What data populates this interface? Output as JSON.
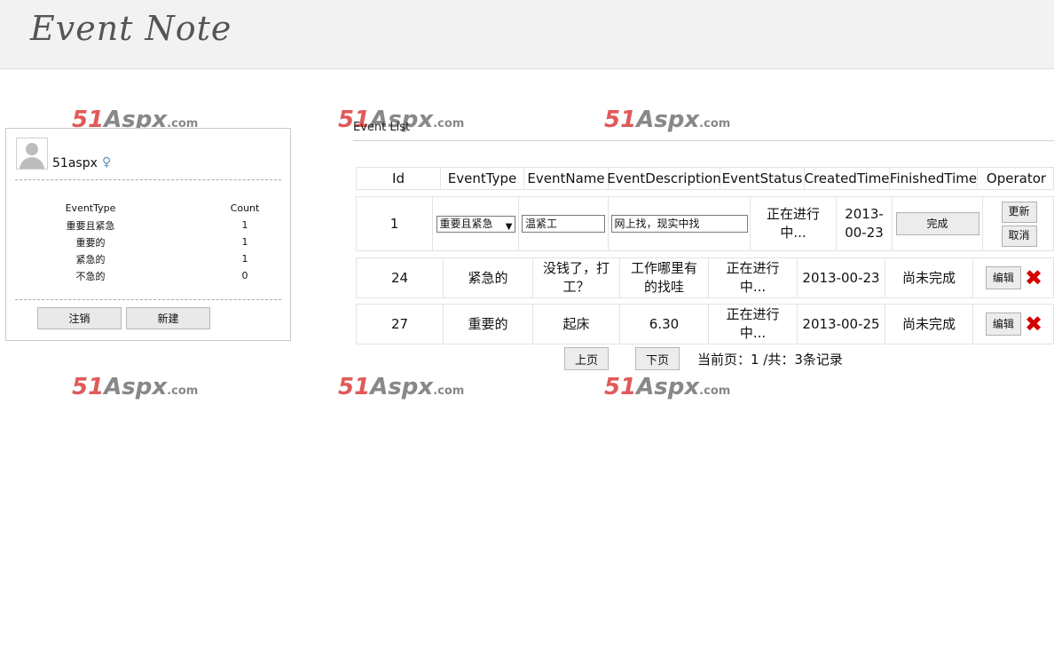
{
  "header": {
    "title": "Event Note"
  },
  "watermark": {
    "num": "51",
    "word": "Aspx",
    "domain": ".com"
  },
  "user": {
    "name": "51aspx",
    "gender_icon": "female-symbol-icon",
    "stats_header": {
      "type": "EventType",
      "count": "Count"
    },
    "stats": [
      {
        "type": "重要且紧急",
        "count": "1"
      },
      {
        "type": "重要的",
        "count": "1"
      },
      {
        "type": "紧急的",
        "count": "1"
      },
      {
        "type": "不急的",
        "count": "0"
      }
    ],
    "logout_label": "注销",
    "new_label": "新建"
  },
  "list": {
    "title": "Event List",
    "columns": [
      "Id",
      "EventType",
      "EventName",
      "EventDescription",
      "EventStatus",
      "CreatedTime",
      "FinishedTime",
      "Operator"
    ],
    "edit_row": {
      "id": "1",
      "type_selected": "重要且紧急",
      "name_value": "温紧工",
      "desc_value": "网上找，现实中找",
      "status": "正在进行中...",
      "created": "2013-00-23",
      "finish_button": "完成",
      "update_button": "更新",
      "cancel_button": "取消"
    },
    "rows": [
      {
        "id": "24",
        "type": "紧急的",
        "name": "没钱了，打工？",
        "desc": "工作哪里有的找哇",
        "status": "正在进行中...",
        "created": "2013-00-23",
        "finished": "尚未完成",
        "edit": "编辑"
      },
      {
        "id": "27",
        "type": "重要的",
        "name": "起床",
        "desc": "6.30",
        "status": "正在进行中...",
        "created": "2013-00-25",
        "finished": "尚未完成",
        "edit": "编辑"
      }
    ],
    "delete_glyph": "✖"
  },
  "pager": {
    "prev": "上页",
    "next": "下页",
    "info": "当前页：1 /共：3条记录"
  },
  "colors": {
    "watermark_red": "#e05a5a",
    "delete_red": "#d40000",
    "header_bg": "#f2f2f2"
  }
}
